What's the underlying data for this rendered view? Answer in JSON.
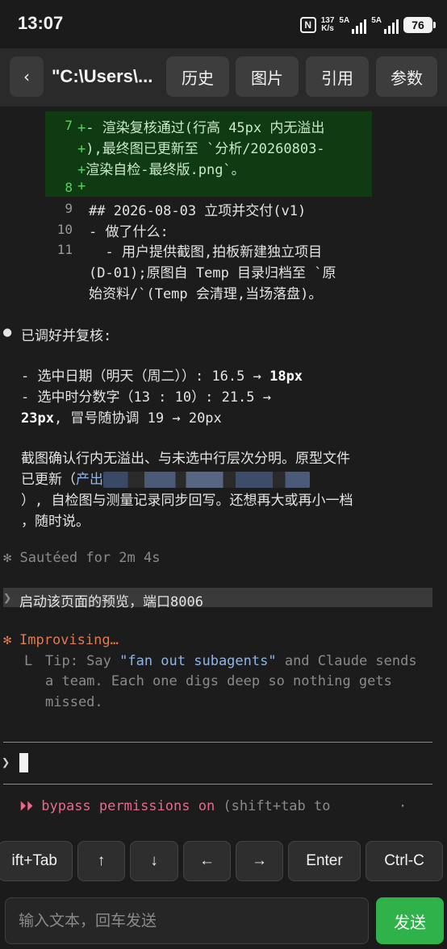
{
  "statusbar": {
    "time": "13:07",
    "nfc": "N",
    "speed_value": "137",
    "speed_unit": "K/s",
    "sim1": "5A",
    "sim2": "5A",
    "battery": "76"
  },
  "header": {
    "back": "‹",
    "title": "\"C:\\Users\\...",
    "buttons": [
      "历史",
      "图片",
      "引用",
      "参数"
    ]
  },
  "terminal": {
    "diff_lines": [
      {
        "num": "7",
        "marker": "+",
        "text": "- 渲染复核通过(行高 45px 内无溢出"
      },
      {
        "num": "",
        "marker": "+",
        "text": "),最终图已更新至 `分析/20260803-"
      },
      {
        "num": "",
        "marker": "+",
        "text": "渲染自检-最终版.png`。"
      },
      {
        "num": "8",
        "marker": "+",
        "text": ""
      }
    ],
    "context_lines": [
      {
        "num": "9",
        "text": "## 2026-08-03 立项并交付(v1)"
      },
      {
        "num": "10",
        "text": "- 做了什么:"
      },
      {
        "num": "11",
        "text": "  - 用户提供截图,拍板新建独立项目"
      },
      {
        "num": "",
        "text": "(D-01);原图自 Temp 目录归档至 `原"
      },
      {
        "num": "",
        "text": "始资料/`(Temp 会清理,当场落盘)。"
      }
    ],
    "bullet": "●",
    "summary_heading": "已调好并复核:",
    "item1_prefix": "- 选中日期（明天（周二））: 16.5 → ",
    "item1_bold": "18px",
    "item2_prefix": "- 选中时分数字（13 : 10）: 21.5 →",
    "item2_bold": "23px",
    "item2_suffix": ", 冒号随协调 19 → 20px",
    "para_line1": "截图确认行内无溢出、与未选中行层次分明。原型文件",
    "para_line2_prefix": "已更新（",
    "para_line2_link": "产出",
    "para_line3": "）, 自检图与测量记录同步回写。还想再大或再小一档",
    "para_line4": "，随时说。",
    "sauteed": "✻ Sautéed for 2m 4s",
    "prompt_glyph": "❯",
    "queued_prompt": "启动该页面的预览，端口8006",
    "improvising_glyph": "✻",
    "improvising": "Improvising…",
    "tip_corner": "L",
    "tip_prefix": "Tip: Say ",
    "tip_quote": "\"fan out subagents\"",
    "tip_suffix": " and Claude sends",
    "tip_line2": "a team. Each one digs deep so nothing gets",
    "tip_line3": "missed.",
    "input_prompt": "❯",
    "bypass_glyph": "⏵⏵",
    "bypass_text": "bypass permissions on",
    "bypass_hint": " (shift+tab to",
    "bypass_dot": "·"
  },
  "keys": [
    "ift+Tab",
    "↑",
    "↓",
    "←",
    "→",
    "Enter",
    "Ctrl-C"
  ],
  "input": {
    "placeholder": "输入文本，回车发送",
    "send": "发送"
  },
  "colors": {
    "send": "#2fb24a",
    "diff_bg": "#0f3a12",
    "accent_orange": "#e07a4f",
    "bypass_pink": "#e66a8a",
    "tip_blue": "#8fb4e8"
  }
}
